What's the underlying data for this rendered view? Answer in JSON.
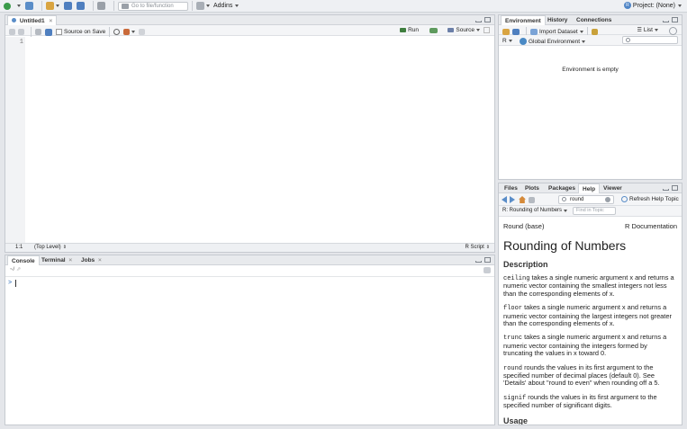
{
  "topbar": {
    "goto_placeholder": "Go to file/function",
    "addins_label": "Addins",
    "project_label": "Project: (None)",
    "project_icon_letter": "R"
  },
  "source": {
    "tab_label": "Untitled1",
    "source_on_save_label": "Source on Save",
    "run_label": "Run",
    "source_label": "Source",
    "line_number": "1",
    "cursor_position": "1:1",
    "scope": "(Top Level)",
    "file_type": "R Script"
  },
  "console": {
    "tabs": [
      "Console",
      "Terminal",
      "Jobs"
    ],
    "path": "~/",
    "prompt": ">"
  },
  "environment": {
    "tabs": [
      "Environment",
      "History",
      "Connections"
    ],
    "import_label": "Import Dataset",
    "list_label": "List",
    "r_label": "R",
    "global_label": "Global Environment",
    "empty_message": "Environment is empty"
  },
  "help": {
    "tabs": [
      "Files",
      "Plots",
      "Packages",
      "Help",
      "Viewer"
    ],
    "search_value": "round",
    "refresh_label": "Refresh Help Topic",
    "topic_select": "R: Rounding of Numbers",
    "find_placeholder": "Find in Topic",
    "doc_left": "Round (base)",
    "doc_right": "R Documentation",
    "title": "Rounding of Numbers",
    "description_heading": "Description",
    "p1_code": "ceiling",
    "p1_text": " takes a single numeric argument x and returns a numeric vector containing the smallest integers not less than the corresponding elements of x.",
    "p2_code": "floor",
    "p2_text": " takes a single numeric argument x and returns a numeric vector containing the largest integers not greater than the corresponding elements of x.",
    "p3_code": "trunc",
    "p3_text": " takes a single numeric argument x and returns a numeric vector containing the integers formed by truncating the values in x toward 0.",
    "p4_code": "round",
    "p4_text": " rounds the values in its first argument to the specified number of decimal places (default 0). See 'Details' about \"round to even\" when rounding off a 5.",
    "p5_code": "signif",
    "p5_text": " rounds the values in its first argument to the specified number of significant digits.",
    "usage_heading": "Usage"
  }
}
